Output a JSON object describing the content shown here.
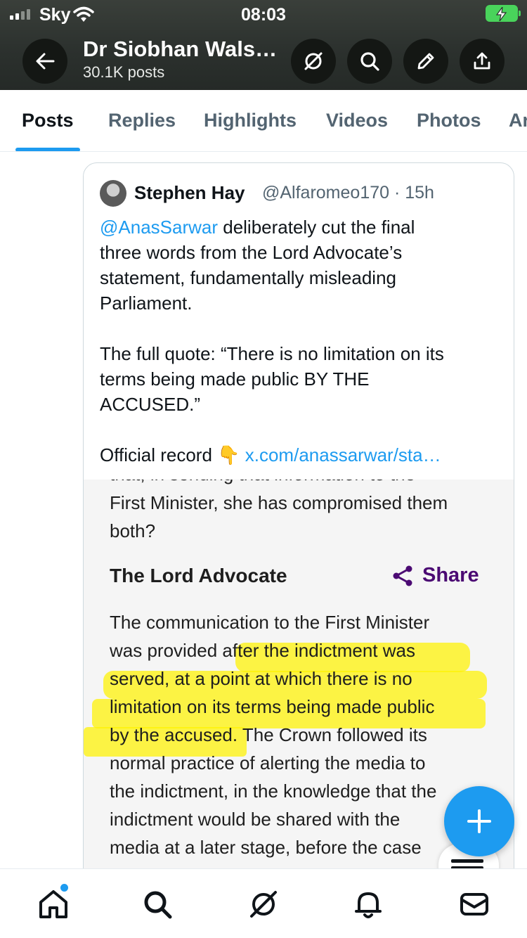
{
  "status_bar": {
    "carrier": "Sky",
    "time": "08:03"
  },
  "header": {
    "title": "Dr Siobhan Wals…",
    "subtitle": "30.1K posts",
    "icons": [
      "back-arrow-icon",
      "grok-icon",
      "search-icon",
      "edit-pencil-icon",
      "share-upload-icon"
    ]
  },
  "tabs": [
    {
      "label": "Posts",
      "active": true
    },
    {
      "label": "Replies"
    },
    {
      "label": "Highlights"
    },
    {
      "label": "Videos"
    },
    {
      "label": "Photos"
    },
    {
      "label": "Ar"
    }
  ],
  "quoted_post": {
    "author": "Stephen Hay",
    "handle_time": "@Alfaromeo170 · 15h",
    "line1_mention": "@AnasSarwar",
    "line1_rest": " deliberately cut the final",
    "line2": "three words from the Lord Advocate’s",
    "line3": "statement, fundamentally misleading",
    "line4": "Parliament.",
    "line5": "The full quote: “There is no limitation on its",
    "line6": "terms being made public BY THE",
    "line7": "ACCUSED.”",
    "line8_prefix": "Official record ",
    "line8_emoji": "👇",
    "line8_link": "x.com/anassarwar/sta…"
  },
  "media": {
    "cut_line": "that, in sending that information to the",
    "line_a": "First Minister, she has compromised them",
    "line_b": "both?",
    "heading": "The Lord Advocate",
    "share_label": "Share",
    "body": [
      "The communication to the First Minister",
      "was provided after the indictment was",
      "served, at a point at which there is no",
      "limitation on its terms being made public",
      "by the accused. The Crown followed its",
      "normal practice of alerting the media to",
      "the indictment, in the knowledge that the",
      "indictment would be shared with the",
      "media at a later stage, before the case"
    ]
  },
  "fab": {
    "icon": "compose-plus-icon"
  },
  "bottom_nav": [
    "home-icon",
    "search-icon",
    "grok-icon",
    "notifications-bell-icon",
    "messages-envelope-icon"
  ],
  "colors": {
    "accent": "#1d9bf0",
    "header_bg": "#2c312e",
    "highlight": "#fff300",
    "share_purple": "#4b0a73",
    "battery_green": "#49d35b"
  }
}
